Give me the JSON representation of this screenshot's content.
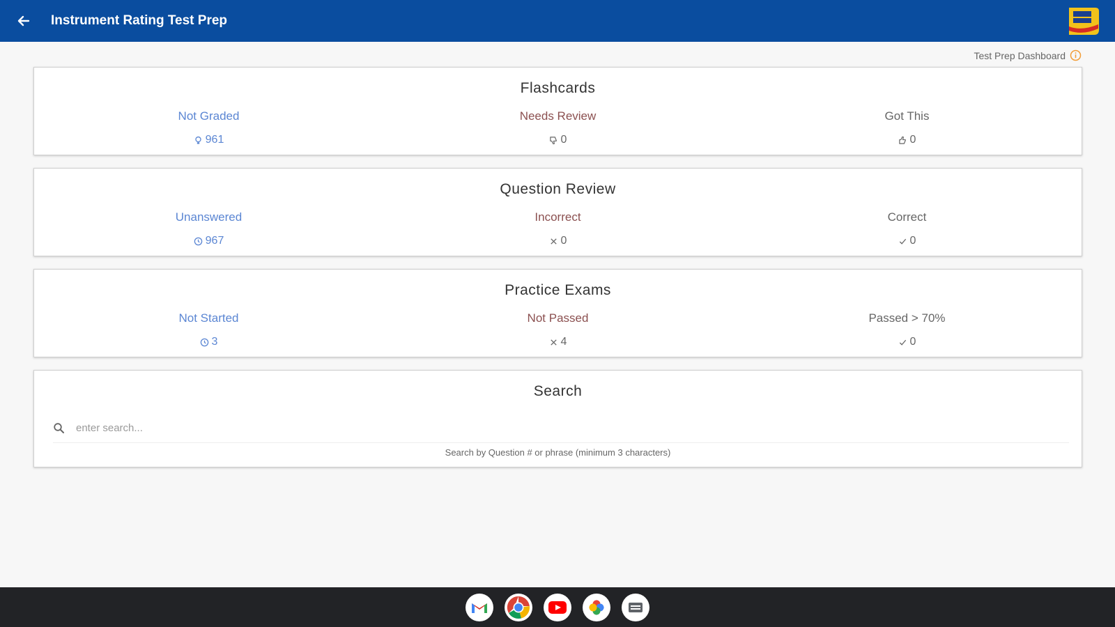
{
  "app": {
    "title": "Instrument Rating Test Prep",
    "brand_color": "#0a4d9f",
    "back_icon": "arrow-left-icon",
    "logo_icon": "king-schools-logo"
  },
  "dashboard_link": {
    "label": "Test Prep Dashboard",
    "icon": "info-icon",
    "icon_color": "#f29d38"
  },
  "flashcards": {
    "title": "Flashcards",
    "not_graded": {
      "label": "Not Graded",
      "value": "961",
      "icon": "bulb-icon"
    },
    "needs_review": {
      "label": "Needs Review",
      "value": "0",
      "icon": "thumbs-down-icon"
    },
    "got_this": {
      "label": "Got This",
      "value": "0",
      "icon": "thumbs-up-icon"
    }
  },
  "question_review": {
    "title": "Question Review",
    "unanswered": {
      "label": "Unanswered",
      "value": "967",
      "icon": "clock-icon"
    },
    "incorrect": {
      "label": "Incorrect",
      "value": "0",
      "icon": "x-icon"
    },
    "correct": {
      "label": "Correct",
      "value": "0",
      "icon": "check-icon"
    }
  },
  "practice_exams": {
    "title": "Practice Exams",
    "not_started": {
      "label": "Not Started",
      "value": "3",
      "icon": "clock-icon"
    },
    "not_passed": {
      "label": "Not Passed",
      "value": "4",
      "icon": "x-icon"
    },
    "passed": {
      "label": "Passed > 70%",
      "value": "0",
      "icon": "check-icon"
    }
  },
  "search": {
    "title": "Search",
    "placeholder": "enter search...",
    "hint": "Search by Question # or phrase (minimum 3 characters)",
    "icon": "search-icon"
  },
  "colors": {
    "blue_text": "#5b86d3",
    "red_text": "#8b5050",
    "gray_text": "#666666"
  },
  "taskbar": {
    "apps": [
      "gmail-icon",
      "chrome-icon",
      "youtube-icon",
      "photos-icon",
      "files-icon"
    ]
  }
}
